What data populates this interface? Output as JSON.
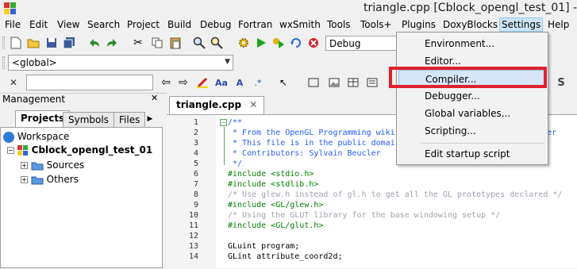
{
  "window": {
    "title": "triangle.cpp [Cblock_opengl_test_01] - C"
  },
  "menubar": [
    "File",
    "Edit",
    "View",
    "Search",
    "Project",
    "Build",
    "Debug",
    "Fortran",
    "wxSmith",
    "Tools",
    "Tools+",
    "Plugins",
    "DoxyBlocks",
    "Settings",
    "Help"
  ],
  "toolbar": {
    "build_target": "Debug",
    "scope": "<global>"
  },
  "management": {
    "title": "Management",
    "tabs": [
      "Projects",
      "Symbols",
      "Files"
    ],
    "tree": {
      "workspace": "Workspace",
      "project": "Cblock_opengl_test_01",
      "folders": [
        "Sources",
        "Others"
      ]
    }
  },
  "editor": {
    "tab": "triangle.cpp",
    "line_numbers": [
      "1",
      "2",
      "3",
      "4",
      "5",
      "6",
      "7",
      "8",
      "9",
      "10",
      "11",
      "12",
      "13",
      "14"
    ],
    "lines": [
      "/**",
      " * From the OpenGL Programming wiki",
      " * This file is in the public domai",
      " * Contributors: Sylvain Beucler",
      " */",
      "#include <stdio.h>",
      "#include <stdlib.h>",
      "/* Use glew.h instead of gl.h to get all the GL prototypes declared */",
      "#include <GL/glew.h>",
      "/* Using the GLUT library for the base windowing setup */",
      "#include <GL/glut.h>",
      "",
      "GLuint program;",
      "GLint attribute_coord2d;"
    ],
    "line2_tail": "iki/Oper"
  },
  "settings_menu": {
    "items": [
      "Environment...",
      "Editor...",
      "Compiler...",
      "Debugger...",
      "Global variables...",
      "Scripting...",
      "Edit startup script"
    ],
    "highlighted": "Compiler..."
  }
}
